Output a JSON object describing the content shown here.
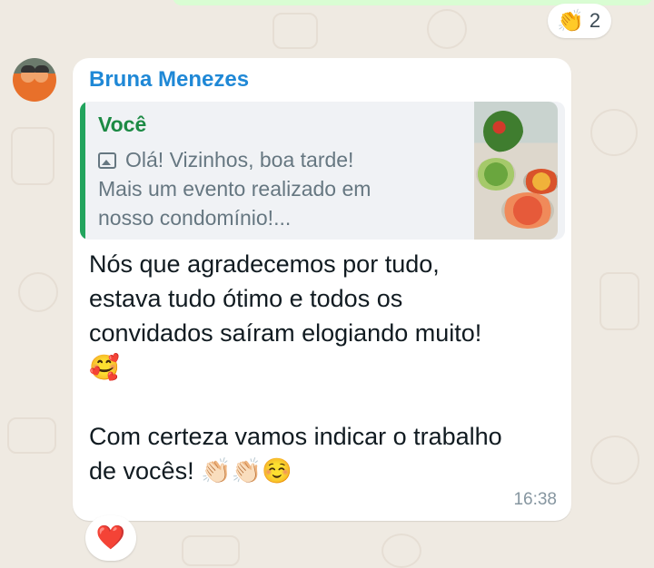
{
  "top_reaction": {
    "emoji": "👏",
    "count": "2"
  },
  "message": {
    "sender": "Bruna Menezes",
    "quoted": {
      "author": "Você",
      "icon": "photo-icon",
      "text": "Olá! Vizinhos, boa tarde!\nMais um evento realizado em\nnosso condomínio!..."
    },
    "body": "Nós que agradecemos por tudo,\nestava tudo ótimo e todos os\nconvidados saíram elogiando muito!\n🥰\n\nCom certeza vamos indicar o trabalho\nde vocês! 👏🏻👏🏻☺️",
    "time": "16:38"
  },
  "bottom_reaction": {
    "emoji": "❤️"
  },
  "colors": {
    "sender": "#1f88d6",
    "quote_author": "#1c8a44",
    "quote_bar": "#22a45d",
    "chat_background": "#efeae2",
    "outgoing_bubble": "#d9fdd3"
  }
}
